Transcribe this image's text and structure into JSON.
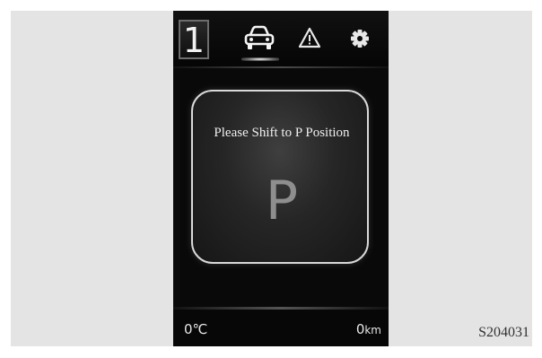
{
  "top_bar": {
    "gear_number": "1",
    "tabs": [
      {
        "icon": "car-icon",
        "active": true
      },
      {
        "icon": "warning-icon",
        "active": false
      },
      {
        "icon": "gear-settings-icon",
        "active": false
      }
    ]
  },
  "message_panel": {
    "message": "Please Shift to P Position",
    "gear_letter": "P"
  },
  "status_bar": {
    "temperature": "0℃",
    "odometer_value": "0",
    "odometer_unit": "km"
  },
  "figure_id": "S204031",
  "colors": {
    "cluster_background": "#090909",
    "frame_background": "#e4e4e4",
    "panel_border": "#d9d9d9",
    "text_primary": "#f0f0f0",
    "gear_letter": "#8e8e8e"
  }
}
